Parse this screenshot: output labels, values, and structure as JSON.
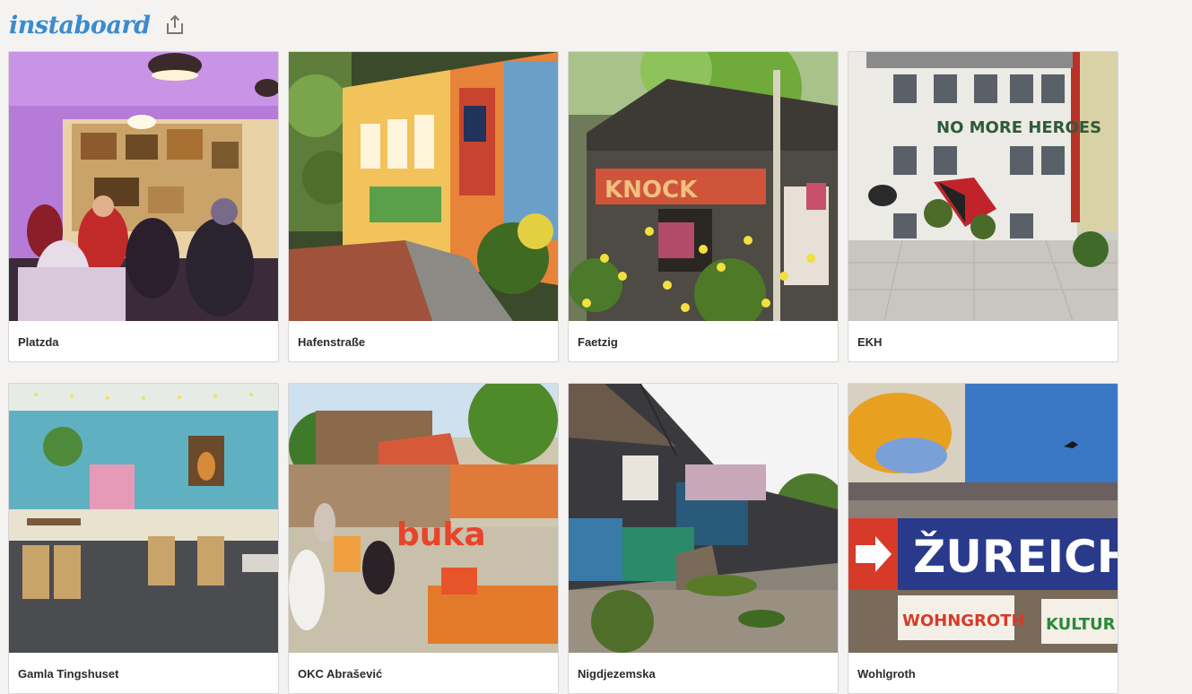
{
  "app": {
    "logo": "instaboard",
    "share_icon": "share-icon"
  },
  "cards": [
    {
      "title": "Platzda",
      "photo_text": ""
    },
    {
      "title": "Hafenstraße",
      "photo_text": ""
    },
    {
      "title": "Faetzig",
      "photo_text": "KNOCK"
    },
    {
      "title": "EKH",
      "photo_text": "NO MORE HEROES"
    },
    {
      "title": "Gamla Tingshuset",
      "photo_text": ""
    },
    {
      "title": "OKC Abrašević",
      "photo_text": "buka"
    },
    {
      "title": "Nigdjezemska",
      "photo_text": ""
    },
    {
      "title": "Wohlgroth",
      "photo_text": "ŽUREICH"
    }
  ]
}
